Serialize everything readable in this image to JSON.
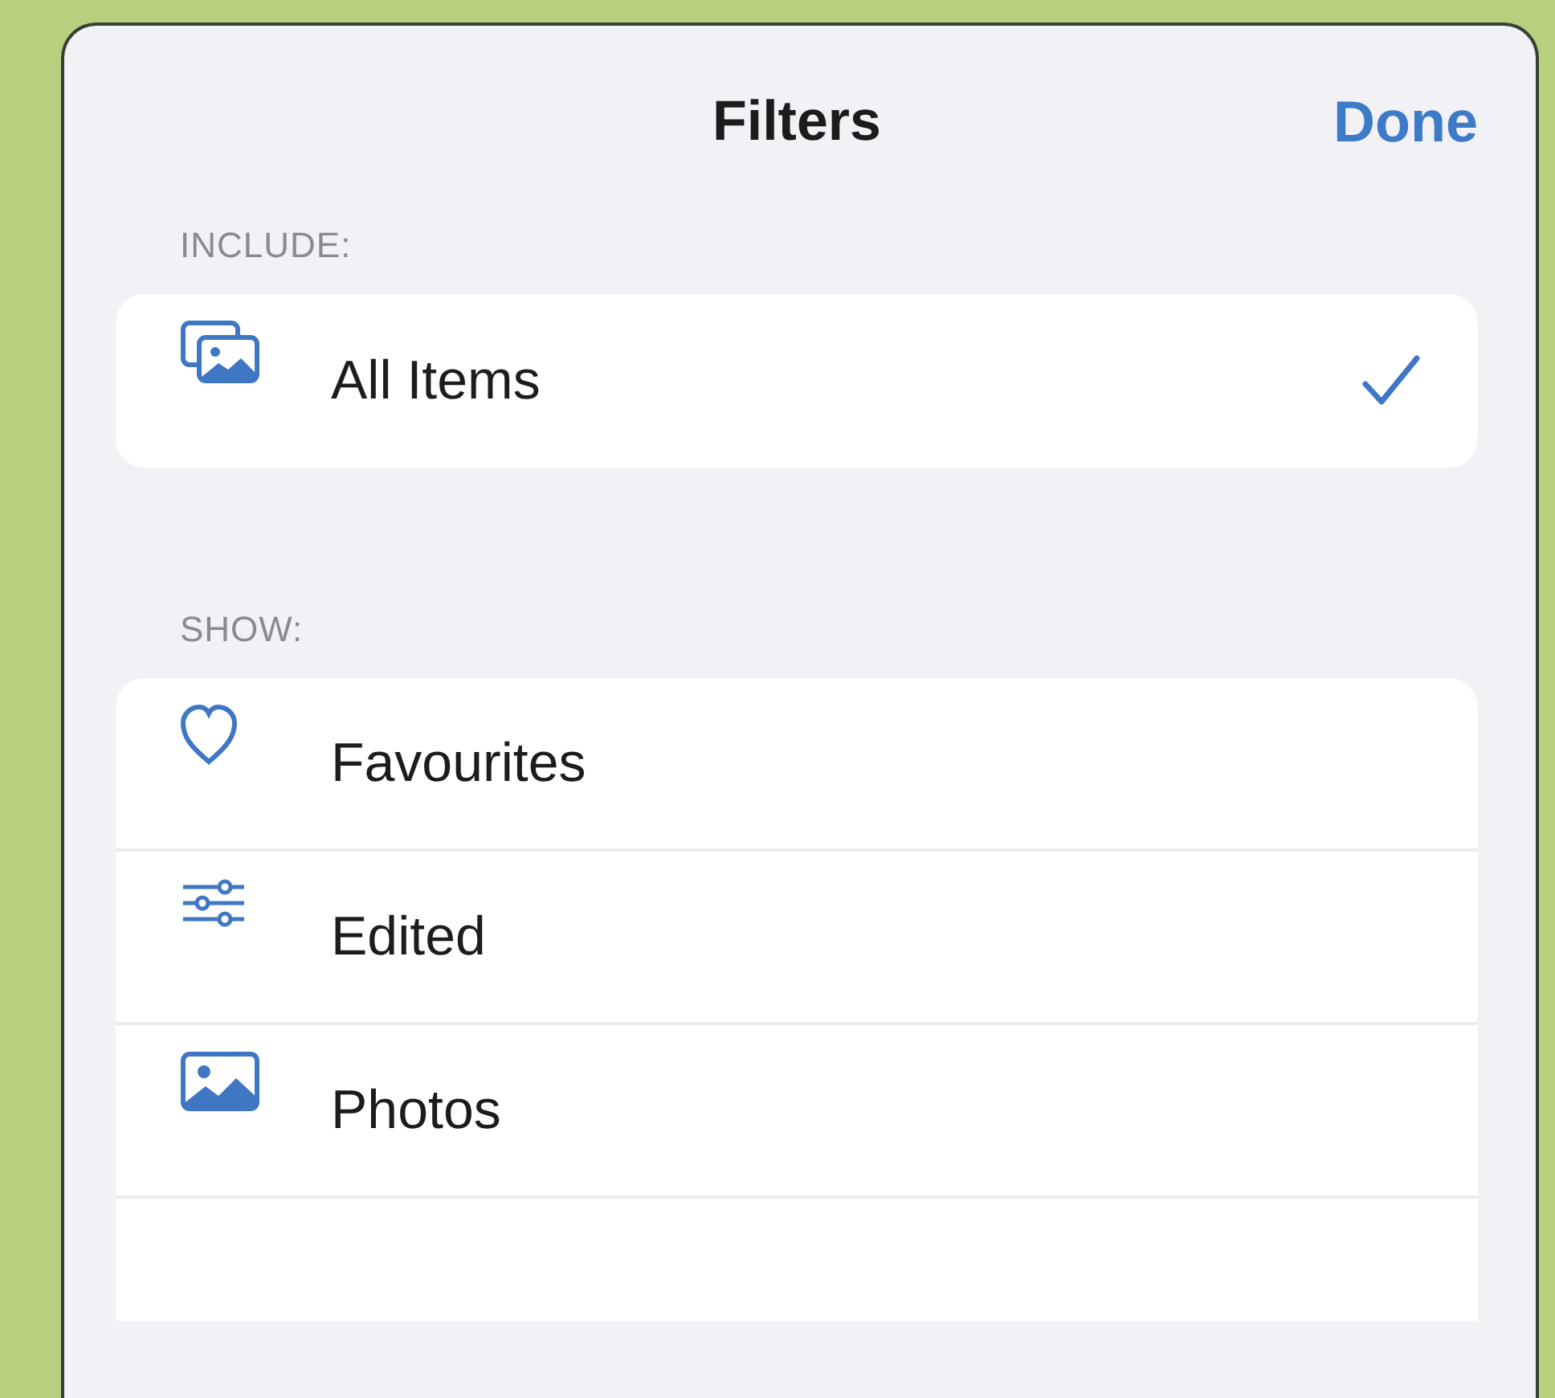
{
  "sheet": {
    "title": "Filters",
    "done_button": "Done"
  },
  "sections": [
    {
      "header": "INCLUDE:",
      "items": [
        {
          "kind": "stack",
          "label": "All Items",
          "selected": true
        }
      ]
    },
    {
      "header": "SHOW:",
      "items": [
        {
          "kind": "heart",
          "label": "Favourites",
          "selected": false
        },
        {
          "kind": "sliders",
          "label": "Edited",
          "selected": false
        },
        {
          "kind": "photo",
          "label": "Photos",
          "selected": false
        }
      ]
    }
  ]
}
